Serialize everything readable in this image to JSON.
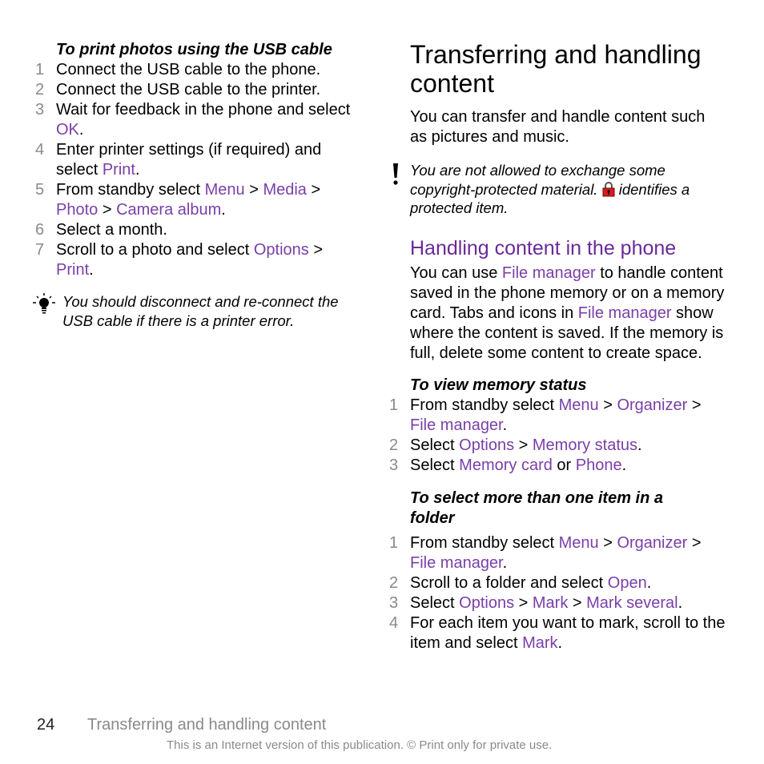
{
  "left": {
    "procedure_title": "To print photos using the USB cable",
    "steps": [
      {
        "num": "1",
        "parts": [
          {
            "t": "Connect the USB cable to the phone."
          }
        ]
      },
      {
        "num": "2",
        "parts": [
          {
            "t": "Connect the USB cable to the printer."
          }
        ]
      },
      {
        "num": "3",
        "parts": [
          {
            "t": "Wait for feedback in the phone and select "
          },
          {
            "t": "OK",
            "link": true
          },
          {
            "t": "."
          }
        ]
      },
      {
        "num": "4",
        "parts": [
          {
            "t": "Enter printer settings (if required) and select "
          },
          {
            "t": "Print",
            "link": true
          },
          {
            "t": "."
          }
        ]
      },
      {
        "num": "5",
        "parts": [
          {
            "t": "From standby select "
          },
          {
            "t": "Menu",
            "link": true
          },
          {
            "t": " > "
          },
          {
            "t": "Media",
            "link": true
          },
          {
            "t": " > "
          },
          {
            "t": "Photo",
            "link": true
          },
          {
            "t": " > "
          },
          {
            "t": "Camera album",
            "link": true
          },
          {
            "t": "."
          }
        ]
      },
      {
        "num": "6",
        "parts": [
          {
            "t": "Select a month."
          }
        ]
      },
      {
        "num": "7",
        "parts": [
          {
            "t": "Scroll to a photo and select "
          },
          {
            "t": "Options",
            "link": true
          },
          {
            "t": " > "
          },
          {
            "t": "Print",
            "link": true
          },
          {
            "t": "."
          }
        ]
      }
    ],
    "tip_text": "You should disconnect and re-connect the USB cable if there is a printer error."
  },
  "right": {
    "heading": "Transferring and handling content",
    "intro": "You can transfer and handle content such as pictures and music.",
    "warning_before_icon": "You are not allowed to exchange some copyright-protected material. ",
    "warning_after_icon": " identifies a protected item.",
    "subheading": "Handling content in the phone",
    "paragraph": [
      {
        "t": "You can use "
      },
      {
        "t": "File manager",
        "link": true
      },
      {
        "t": " to handle content saved in the phone memory or on a memory card. Tabs and icons in "
      },
      {
        "t": "File manager",
        "link": true
      },
      {
        "t": " show where the content is saved. If the memory is full, delete some content to create space."
      }
    ],
    "procedure1_title": "To view memory status",
    "procedure1_steps": [
      {
        "num": "1",
        "parts": [
          {
            "t": "From standby select "
          },
          {
            "t": "Menu",
            "link": true
          },
          {
            "t": " > "
          },
          {
            "t": "Organizer",
            "link": true
          },
          {
            "t": " > "
          },
          {
            "t": "File manager",
            "link": true
          },
          {
            "t": "."
          }
        ]
      },
      {
        "num": "2",
        "parts": [
          {
            "t": "Select "
          },
          {
            "t": "Options",
            "link": true
          },
          {
            "t": " > "
          },
          {
            "t": "Memory status",
            "link": true
          },
          {
            "t": "."
          }
        ]
      },
      {
        "num": "3",
        "parts": [
          {
            "t": "Select "
          },
          {
            "t": "Memory card",
            "link": true
          },
          {
            "t": " or "
          },
          {
            "t": "Phone",
            "link": true
          },
          {
            "t": "."
          }
        ]
      }
    ],
    "procedure2_title": "To select more than one item in a folder",
    "procedure2_steps": [
      {
        "num": "1",
        "parts": [
          {
            "t": "From standby select "
          },
          {
            "t": "Menu",
            "link": true
          },
          {
            "t": " > "
          },
          {
            "t": "Organizer",
            "link": true
          },
          {
            "t": " > "
          },
          {
            "t": "File manager",
            "link": true
          },
          {
            "t": "."
          }
        ]
      },
      {
        "num": "2",
        "parts": [
          {
            "t": "Scroll to a folder and select "
          },
          {
            "t": "Open",
            "link": true
          },
          {
            "t": "."
          }
        ]
      },
      {
        "num": "3",
        "parts": [
          {
            "t": "Select "
          },
          {
            "t": "Options",
            "link": true
          },
          {
            "t": " > "
          },
          {
            "t": "Mark",
            "link": true
          },
          {
            "t": " > "
          },
          {
            "t": "Mark several",
            "link": true
          },
          {
            "t": "."
          }
        ]
      },
      {
        "num": "4",
        "parts": [
          {
            "t": "For each item you want to mark, scroll to the item and select "
          },
          {
            "t": "Mark",
            "link": true
          },
          {
            "t": "."
          }
        ]
      }
    ]
  },
  "footer": {
    "page_number": "24",
    "chapter": "Transferring and handling content",
    "copyright": "This is an Internet version of this publication. © Print only for private use."
  },
  "colors": {
    "link": "#7a3fa8",
    "heading2": "#6a2a9a",
    "step_number": "#8a8a8a"
  },
  "icons": {
    "tip": "lightbulb-icon",
    "warning": "exclamation-icon",
    "protected": "padlock-icon"
  }
}
